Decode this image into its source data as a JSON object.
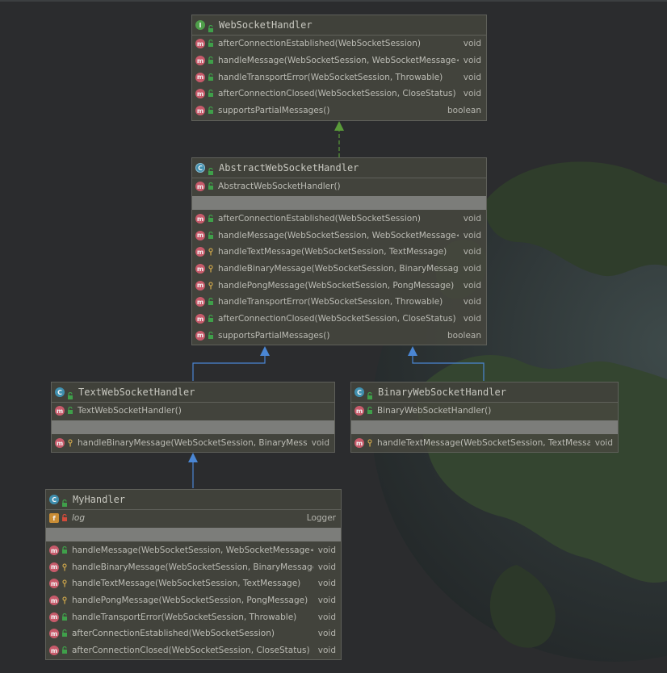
{
  "colors": {
    "background": "#2b2c2e",
    "box": "#48483f",
    "method_badge": "#c75a6a",
    "interface_badge": "#4f9e4a",
    "class_badge": "#3f8fae",
    "implements_arrow": "#5a9a3a",
    "extends_arrow": "#4a86d4"
  },
  "classes": {
    "websockethandler": {
      "name": "WebSocketHandler",
      "kind": "I",
      "methods": [
        {
          "name": "afterConnectionEstablished(WebSocketSession)",
          "type": "void",
          "vis": "public"
        },
        {
          "name": "handleMessage(WebSocketSession, WebSocketMessage<?>)",
          "type": "void",
          "vis": "public"
        },
        {
          "name": "handleTransportError(WebSocketSession, Throwable)",
          "type": "void",
          "vis": "public"
        },
        {
          "name": "afterConnectionClosed(WebSocketSession, CloseStatus)",
          "type": "void",
          "vis": "public"
        },
        {
          "name": "supportsPartialMessages()",
          "type": "boolean",
          "vis": "public"
        }
      ]
    },
    "abstract": {
      "name": "AbstractWebSocketHandler",
      "kind": "C",
      "constructors": [
        {
          "name": "AbstractWebSocketHandler()",
          "type": "",
          "vis": "public"
        }
      ],
      "methods": [
        {
          "name": "afterConnectionEstablished(WebSocketSession)",
          "type": "void",
          "vis": "public"
        },
        {
          "name": "handleMessage(WebSocketSession, WebSocketMessage<?>)",
          "type": "void",
          "vis": "public"
        },
        {
          "name": "handleTextMessage(WebSocketSession, TextMessage)",
          "type": "void",
          "vis": "protected"
        },
        {
          "name": "handleBinaryMessage(WebSocketSession, BinaryMessage)",
          "type": "void",
          "vis": "protected"
        },
        {
          "name": "handlePongMessage(WebSocketSession, PongMessage)",
          "type": "void",
          "vis": "protected"
        },
        {
          "name": "handleTransportError(WebSocketSession, Throwable)",
          "type": "void",
          "vis": "public"
        },
        {
          "name": "afterConnectionClosed(WebSocketSession, CloseStatus)",
          "type": "void",
          "vis": "public"
        },
        {
          "name": "supportsPartialMessages()",
          "type": "boolean",
          "vis": "public"
        }
      ]
    },
    "text": {
      "name": "TextWebSocketHandler",
      "kind": "C",
      "constructors": [
        {
          "name": "TextWebSocketHandler()",
          "type": "",
          "vis": "public"
        }
      ],
      "methods": [
        {
          "name": "handleBinaryMessage(WebSocketSession, BinaryMessage)",
          "type": "void",
          "vis": "protected"
        }
      ]
    },
    "binary": {
      "name": "BinaryWebSocketHandler",
      "kind": "C",
      "constructors": [
        {
          "name": "BinaryWebSocketHandler()",
          "type": "",
          "vis": "public"
        }
      ],
      "methods": [
        {
          "name": "handleTextMessage(WebSocketSession, TextMessage)",
          "type": "void",
          "vis": "protected"
        }
      ]
    },
    "my": {
      "name": "MyHandler",
      "kind": "C",
      "fields": [
        {
          "name": "log",
          "type": "Logger",
          "vis": "private"
        }
      ],
      "methods": [
        {
          "name": "handleMessage(WebSocketSession, WebSocketMessage<?>)",
          "type": "void",
          "vis": "public"
        },
        {
          "name": "handleBinaryMessage(WebSocketSession, BinaryMessage)",
          "type": "void",
          "vis": "protected"
        },
        {
          "name": "handleTextMessage(WebSocketSession, TextMessage)",
          "type": "void",
          "vis": "protected"
        },
        {
          "name": "handlePongMessage(WebSocketSession, PongMessage)",
          "type": "void",
          "vis": "protected"
        },
        {
          "name": "handleTransportError(WebSocketSession, Throwable)",
          "type": "void",
          "vis": "public"
        },
        {
          "name": "afterConnectionEstablished(WebSocketSession)",
          "type": "void",
          "vis": "public"
        },
        {
          "name": "afterConnectionClosed(WebSocketSession, CloseStatus)",
          "type": "void",
          "vis": "public"
        }
      ]
    }
  }
}
